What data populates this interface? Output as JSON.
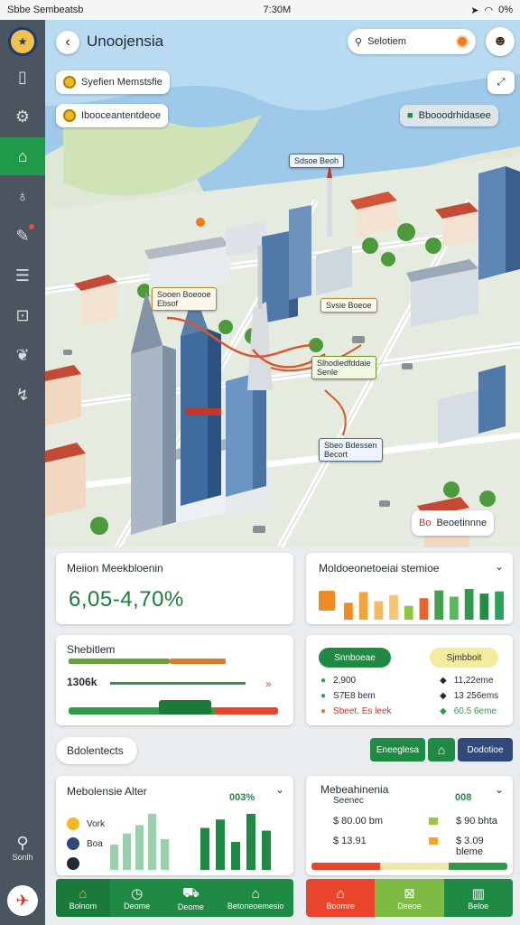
{
  "status": {
    "left": "Sbbe Sembeatsb",
    "time": "7:30M",
    "battery": "0%"
  },
  "header": {
    "title": "Unoojensia",
    "search_placeholder": "Selotiem"
  },
  "map": {
    "pills": {
      "top": "Syefien Memstsfie",
      "second": "Ibooceantentdeoe",
      "right": "Bbooodrhidasee"
    },
    "labels": {
      "tower": "Sdsoe Beoh",
      "l1": "Sooen Boeooe",
      "l1b": "Ebsof",
      "l2": "Svsie Boeoe",
      "l3": "Slhodiedfddaie",
      "l3b": "Senle",
      "l4": "Sbeo Bdessen",
      "l4b": "Becort",
      "l5": "Beoetinnne",
      "l5pre": "Bo"
    }
  },
  "sidebar": {
    "bottom_label": "Sonlh"
  },
  "card_market": {
    "title": "Meiion Meekbloenin",
    "value": "6,05-4,70%",
    "bars": [
      {
        "v": 0.55,
        "c": "#f08a23"
      },
      {
        "v": 0.9,
        "c": "#f2a33a"
      },
      {
        "v": 0.6,
        "c": "#f5b960"
      },
      {
        "v": 0.8,
        "c": "#f5c572"
      },
      {
        "v": 0.45,
        "c": "#8cc63f"
      },
      {
        "v": 0.7,
        "c": "#e8642a"
      },
      {
        "v": 0.95,
        "c": "#3fa34d"
      },
      {
        "v": 0.75,
        "c": "#5bb85d"
      },
      {
        "v": 1.0,
        "c": "#2e9a4a"
      },
      {
        "v": 0.85,
        "c": "#1f8e46"
      },
      {
        "v": 0.92,
        "c": "#27a35a"
      }
    ]
  },
  "card_mobility": {
    "title": "Moldoeonetoeiai stemioe"
  },
  "card_stat": {
    "title": "Shebitlem",
    "value": "1306k",
    "arrows": "»"
  },
  "card_split": {
    "left_btn": "Snnboeae",
    "right_btn": "Sjmbboit",
    "left_rows": [
      "2,900",
      "S7E8 bem",
      "Sbeet. Es leek"
    ],
    "right_rows": [
      "11,22eme",
      "13 256ems",
      "60.5 6eme"
    ]
  },
  "section": {
    "title": "Bdolentects"
  },
  "section_buttons": [
    "Eneeglesa",
    "⌂",
    "Dodotioe"
  ],
  "card_tracker": {
    "title": "Mebolensie Alter",
    "pct": "003%",
    "legend": [
      "Vork",
      "Boa",
      ""
    ],
    "bars": [
      0.45,
      0.65,
      0.8,
      1.0,
      0.55,
      0.75,
      0.9,
      0.5,
      1.0,
      0.7
    ],
    "buttons": [
      "Bolnom",
      "Deome",
      "Deome",
      "Betoneoemesio"
    ]
  },
  "card_finance": {
    "title": "Mebeahinenia",
    "subtitle": "Seenec",
    "pct": "008",
    "rows": [
      {
        "left": "$ 80.00 bm",
        "right": "$ 90 bhta",
        "c1": "#9bc53d",
        "c2": "#6cbf4a"
      },
      {
        "left": "$ 13.91",
        "right": "$ 3.09 bleme",
        "c1": "#f5a623",
        "c2": "#2e9a4a"
      }
    ],
    "buttons": [
      "Boomre",
      "Deeoe",
      "Beloe"
    ]
  },
  "colors": {
    "green": "#1f8a44",
    "orange": "#e8552a",
    "navy": "#2f4a7a",
    "sidebar": "#4b5560"
  }
}
